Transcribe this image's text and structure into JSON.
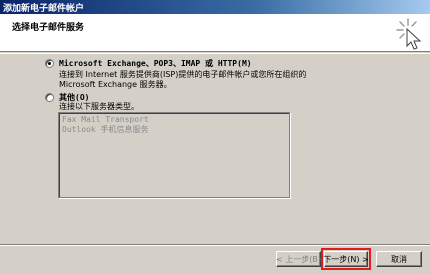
{
  "window": {
    "title": "添加新电子邮件帐户"
  },
  "header": {
    "heading": "选择电子邮件服务",
    "icon": "wizard-sparkle-icon"
  },
  "options": {
    "exchange": {
      "label": "Microsoft Exchange、POP3、IMAP 或 HTTP(M)",
      "desc_line1": "连接到 Internet 服务提供商(ISP)提供的电子邮件帐户或您所在组织的",
      "desc_line2": "Microsoft Exchange 服务器。",
      "selected": true
    },
    "other": {
      "label": "其他(O)",
      "desc": "连接以下服务器类型。",
      "selected": false,
      "services": [
        "Fax Mail Transport",
        "Outlook 手机信息服务"
      ]
    }
  },
  "buttons": {
    "back": "< 上一步(B)",
    "next": "下一步(N) >",
    "cancel": "取消"
  },
  "colors": {
    "highlight": "#e21b1b",
    "titlebar": "#0a246a"
  }
}
